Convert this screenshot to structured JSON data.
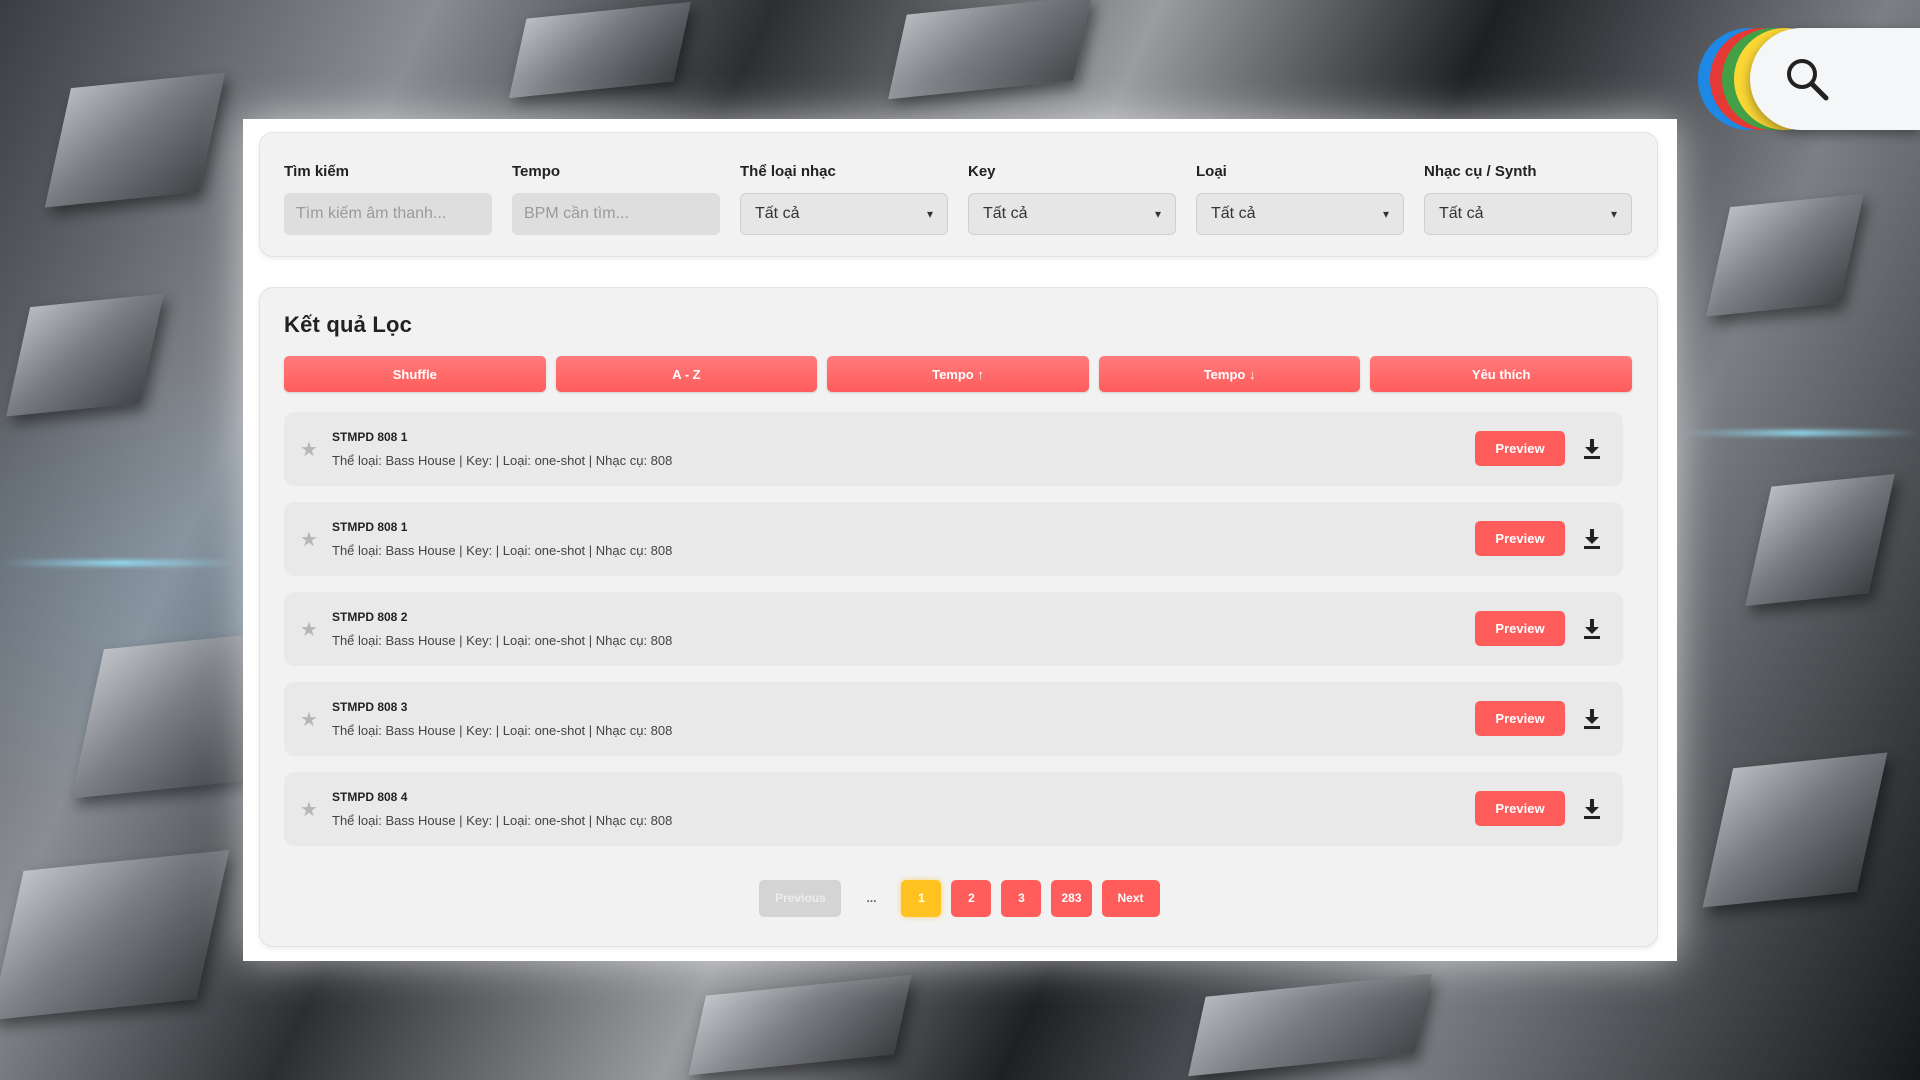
{
  "filters": {
    "search": {
      "label": "Tìm kiếm",
      "placeholder": "Tìm kiếm âm thanh..."
    },
    "tempo": {
      "label": "Tempo",
      "placeholder": "BPM cần tìm..."
    },
    "genre": {
      "label": "Thể loại nhạc",
      "value": "Tất cả"
    },
    "key": {
      "label": "Key",
      "value": "Tất cả"
    },
    "type": {
      "label": "Loại",
      "value": "Tất cả"
    },
    "instrument": {
      "label": "Nhạc cụ / Synth",
      "value": "Tất cả"
    }
  },
  "results": {
    "title": "Kết quả Lọc",
    "sort_buttons": [
      "Shuffle",
      "A - Z",
      "Tempo ↑",
      "Tempo ↓",
      "Yêu thích"
    ],
    "items": [
      {
        "name": "STMPD 808 1",
        "meta": "Thể loại: Bass House | Key: | Loại: one-shot | Nhạc cụ: 808",
        "preview_label": "Preview"
      },
      {
        "name": "STMPD 808 1",
        "meta": "Thể loại: Bass House | Key: | Loại: one-shot | Nhạc cụ: 808",
        "preview_label": "Preview"
      },
      {
        "name": "STMPD 808 2",
        "meta": "Thể loại: Bass House | Key: | Loại: one-shot | Nhạc cụ: 808",
        "preview_label": "Preview"
      },
      {
        "name": "STMPD 808 3",
        "meta": "Thể loại: Bass House | Key: | Loại: one-shot | Nhạc cụ: 808",
        "preview_label": "Preview"
      },
      {
        "name": "STMPD 808 4",
        "meta": "Thể loại: Bass House | Key: | Loại: one-shot | Nhạc cụ: 808",
        "preview_label": "Preview"
      }
    ]
  },
  "pagination": {
    "previous": "Previous",
    "ellipsis": "...",
    "pages": [
      "1",
      "2",
      "3",
      "283"
    ],
    "current": "1",
    "next": "Next"
  },
  "colors": {
    "accent": "#ff5c5c",
    "active_page": "#ffc220"
  },
  "icons": {
    "favorite": "star-icon",
    "download": "download-icon",
    "logo": "search-icon"
  }
}
